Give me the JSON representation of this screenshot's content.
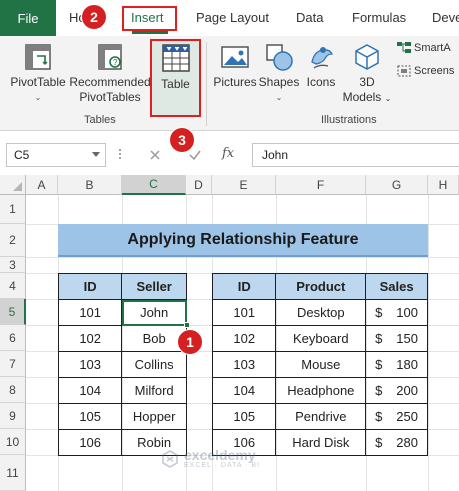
{
  "ribbon_tabs": {
    "file": "File",
    "home": "Ho",
    "insert": "Insert",
    "page_layout": "Page Layout",
    "data": "Data",
    "formulas": "Formulas",
    "developer": "Deve"
  },
  "ribbon": {
    "pivottable": "PivotTable",
    "recommended_line1": "Recommended",
    "recommended_line2": "PivotTables",
    "table": "Table",
    "pictures": "Pictures",
    "shapes": "Shapes",
    "icons": "Icons",
    "models_line1": "3D",
    "models_line2": "Models",
    "smartart": "SmartA",
    "screenshot": "Screens",
    "group_tables": "Tables",
    "group_illustrations": "Illustrations"
  },
  "badges": {
    "one": "1",
    "two": "2",
    "three": "3"
  },
  "formula_bar": {
    "name_box": "C5",
    "fx": "fx",
    "value": "John"
  },
  "columns": [
    "A",
    "B",
    "C",
    "D",
    "E",
    "F",
    "G",
    "H"
  ],
  "rows": [
    "1",
    "2",
    "3",
    "4",
    "5",
    "6",
    "7",
    "8",
    "9",
    "10",
    "11"
  ],
  "active": {
    "column": "C",
    "row": "5"
  },
  "sheet_title": "Applying Relationship Feature",
  "seller_table": {
    "headers": [
      "ID",
      "Seller"
    ],
    "rows": [
      [
        "101",
        "John"
      ],
      [
        "102",
        "Bob"
      ],
      [
        "103",
        "Collins"
      ],
      [
        "104",
        "Milford"
      ],
      [
        "105",
        "Hopper"
      ],
      [
        "106",
        "Robin"
      ]
    ]
  },
  "product_table": {
    "headers": [
      "ID",
      "Product",
      "Sales"
    ],
    "rows": [
      [
        "101",
        "Desktop",
        "$",
        "100"
      ],
      [
        "102",
        "Keyboard",
        "$",
        "150"
      ],
      [
        "103",
        "Mouse",
        "$",
        "180"
      ],
      [
        "104",
        "Headphone",
        "$",
        "200"
      ],
      [
        "105",
        "Pendrive",
        "$",
        "250"
      ],
      [
        "106",
        "Hard Disk",
        "$",
        "280"
      ]
    ]
  },
  "watermark": {
    "name": "exceldemy",
    "tagline": "EXCEL · DATA · BI"
  },
  "colors": {
    "excel_green": "#217346",
    "highlight_red": "#e02020",
    "badge_red": "#d42020",
    "title_fill": "#9dc3e6",
    "header_fill": "#bdd7ee"
  }
}
